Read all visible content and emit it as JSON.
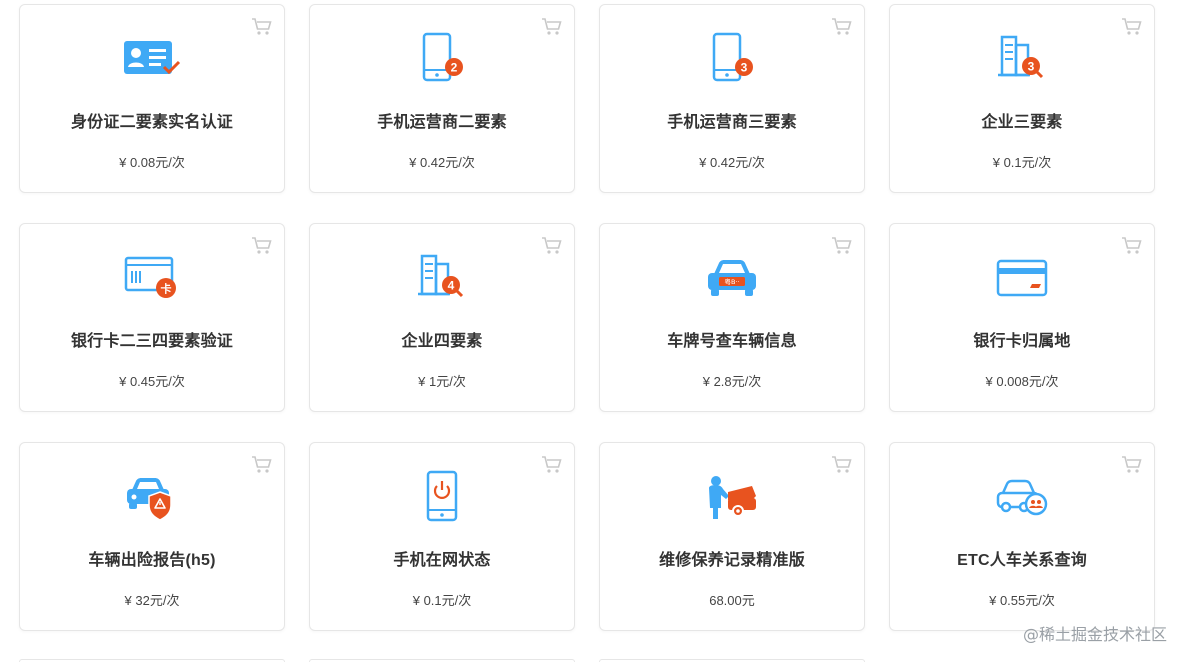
{
  "products": [
    {
      "title": "身份证二要素实名认证",
      "price": "¥ 0.08元/次",
      "icon": "id-card-check-icon"
    },
    {
      "title": "手机运营商二要素",
      "price": "¥ 0.42元/次",
      "icon": "phone-badge-2-icon",
      "badge": "2"
    },
    {
      "title": "手机运营商三要素",
      "price": "¥ 0.42元/次",
      "icon": "phone-badge-3-icon",
      "badge": "3"
    },
    {
      "title": "企业三要素",
      "price": "¥ 0.1元/次",
      "icon": "building-search-3-icon",
      "badge": "3"
    },
    {
      "title": "银行卡二三四要素验证",
      "price": "¥ 0.45元/次",
      "icon": "bank-card-badge-icon",
      "badge": "卡"
    },
    {
      "title": "企业四要素",
      "price": "¥ 1元/次",
      "icon": "building-search-4-icon",
      "badge": "4"
    },
    {
      "title": "车牌号查车辆信息",
      "price": "¥ 2.8元/次",
      "icon": "car-plate-icon",
      "plate": "粤B··"
    },
    {
      "title": "银行卡归属地",
      "price": "¥ 0.008元/次",
      "icon": "bank-card-icon"
    },
    {
      "title": "车辆出险报告(h5)",
      "price": "¥ 32元/次",
      "icon": "car-warning-shield-icon"
    },
    {
      "title": "手机在网状态",
      "price": "¥ 0.1元/次",
      "icon": "phone-power-icon"
    },
    {
      "title": "维修保养记录精准版",
      "price": "68.00元",
      "icon": "car-repair-icon"
    },
    {
      "title": "ETC人车关系查询",
      "price": "¥ 0.55元/次",
      "icon": "car-people-icon"
    }
  ],
  "watermark": "@稀土掘金技术社区",
  "colors": {
    "blue": "#3fa9f5",
    "orange": "#e8531f",
    "cart": "#c8c8c8"
  }
}
